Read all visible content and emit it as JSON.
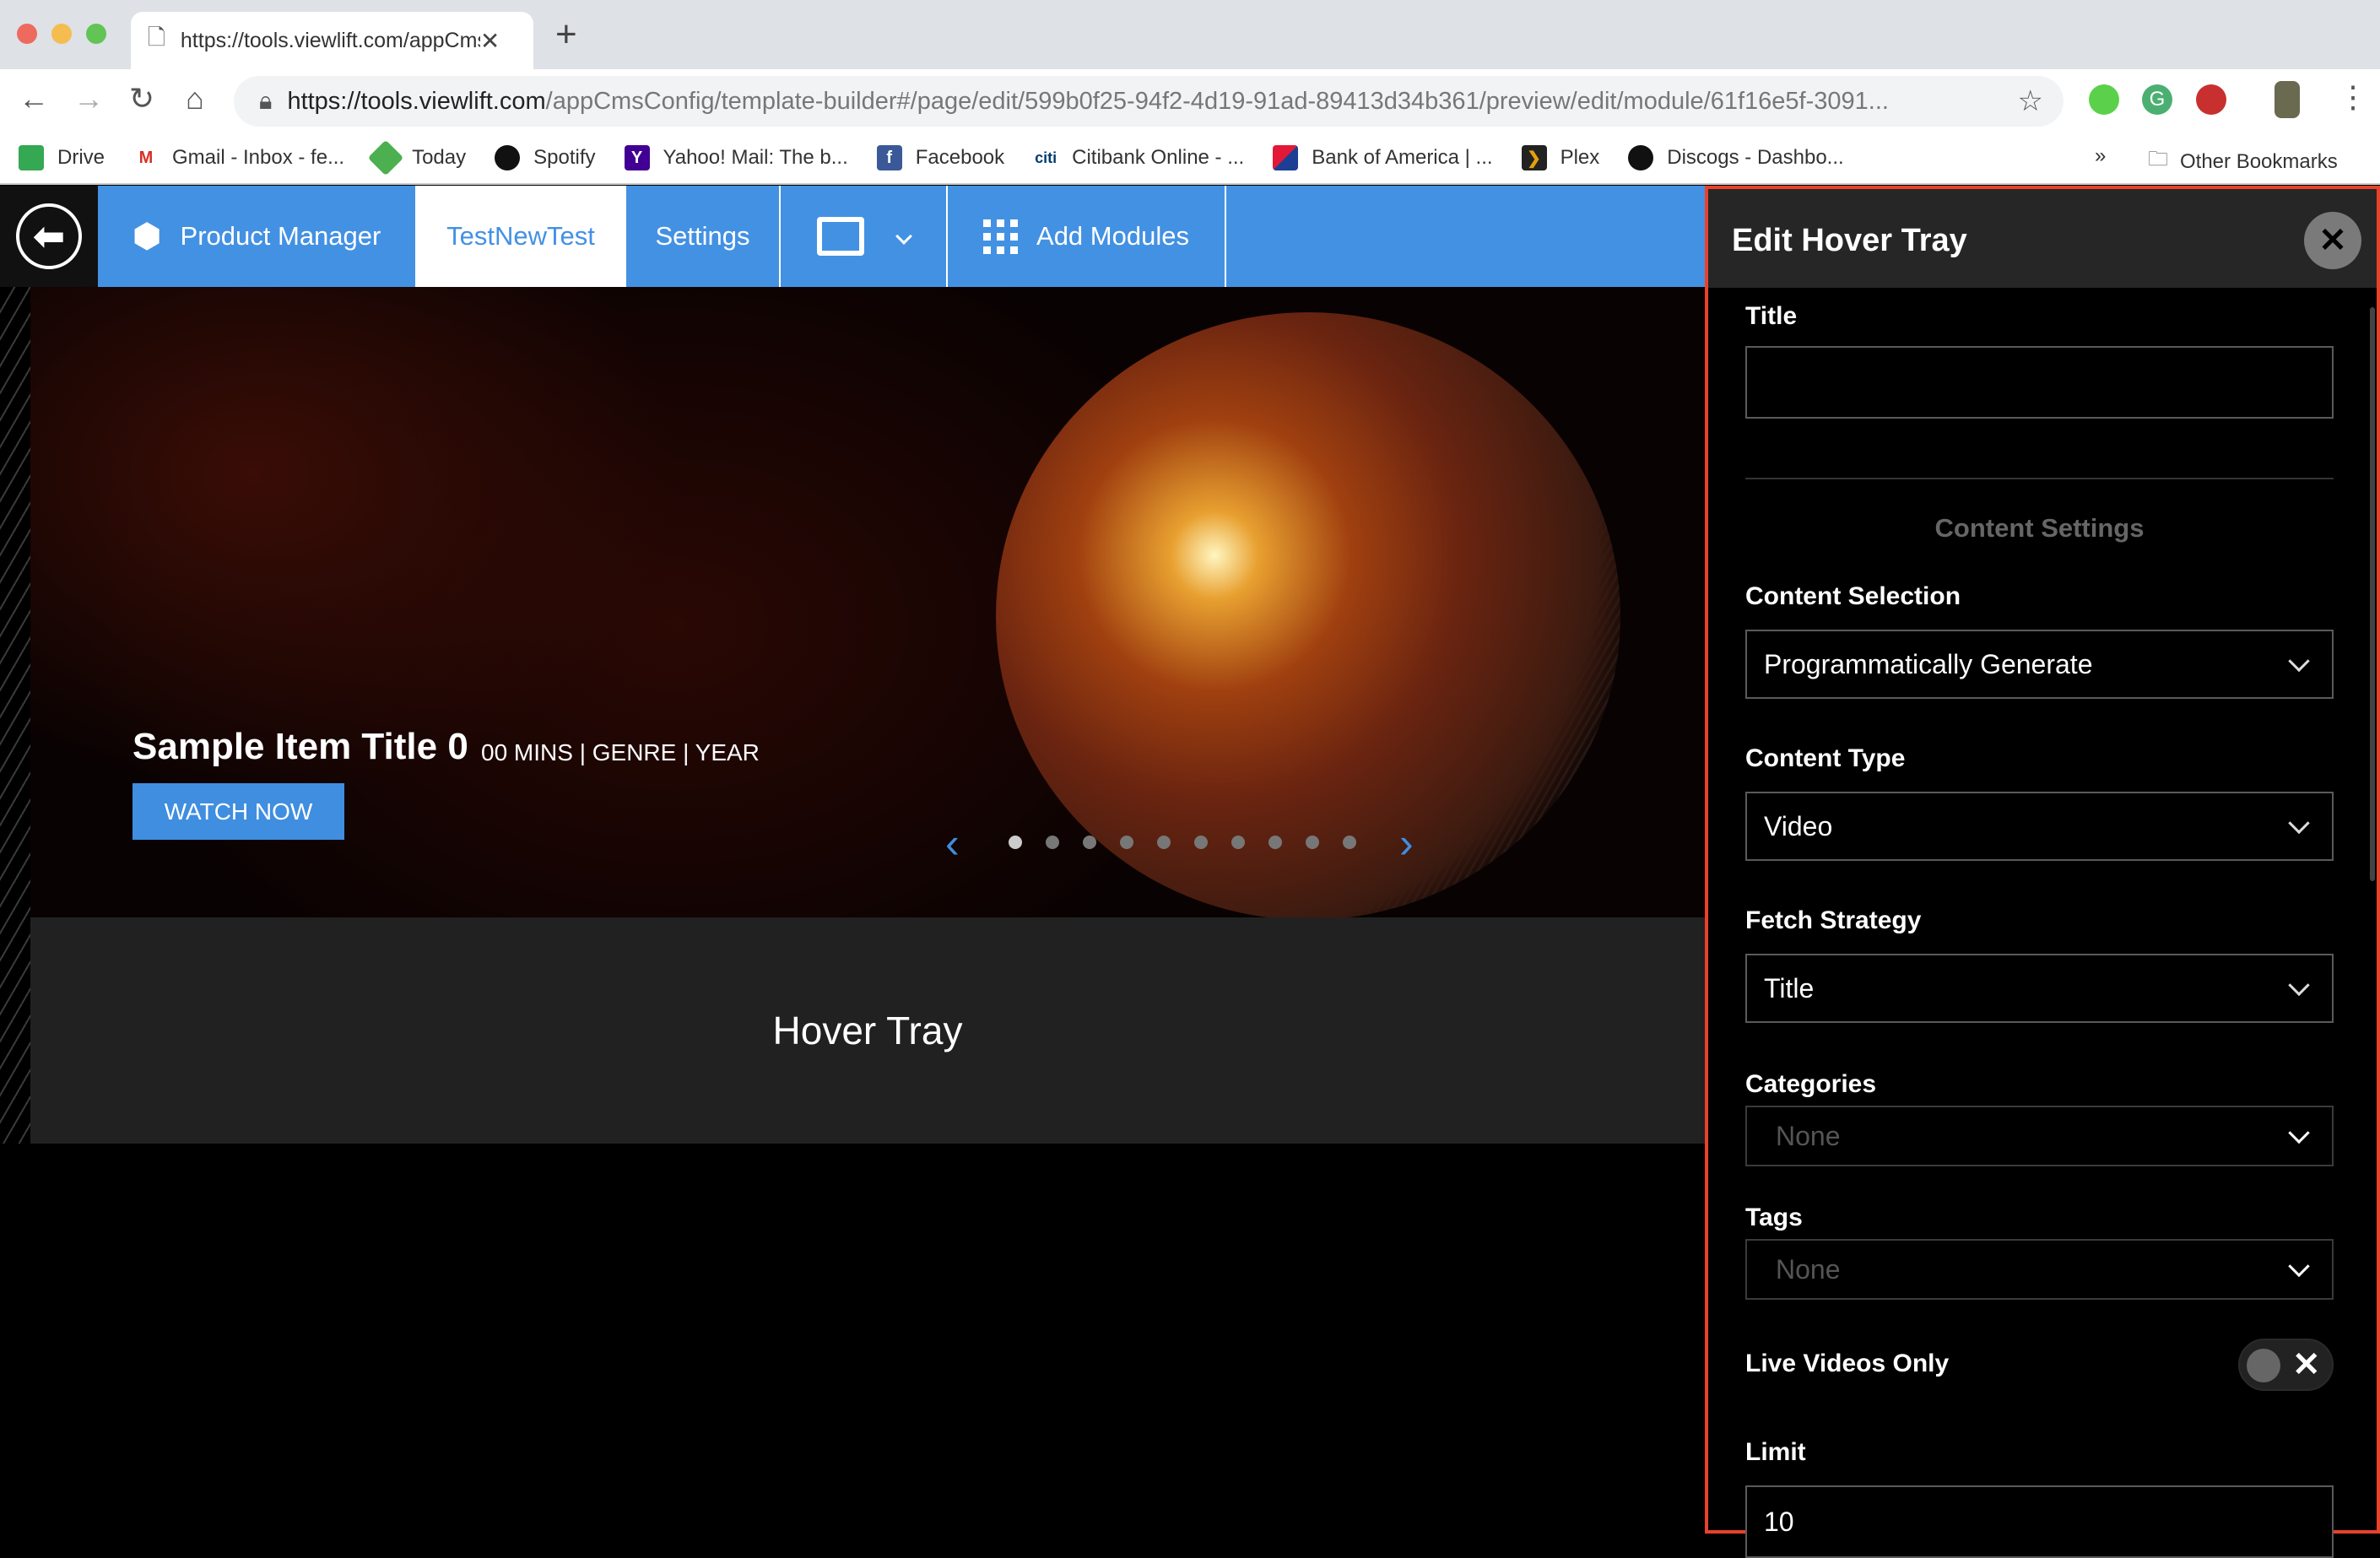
{
  "browser": {
    "tab_title": "https://tools.viewlift.com/appCmsConfig",
    "url_host": "https://tools.viewlift.com",
    "url_path": "/appCmsConfig/template-builder#/page/edit/599b0f25-94f2-4d19-91ad-89413d34b361/preview/edit/module/61f16e5f-3091...",
    "bookmarks": [
      {
        "label": "Drive",
        "icon": "drive-icon",
        "color": "#34a853"
      },
      {
        "label": "Gmail - Inbox - fe...",
        "icon": "gmail-icon",
        "color": "#d93025"
      },
      {
        "label": "Today",
        "icon": "today-icon",
        "color": "#4caf50"
      },
      {
        "label": "Spotify",
        "icon": "spotify-icon",
        "color": "#111111"
      },
      {
        "label": "Yahoo! Mail: The b...",
        "icon": "yahoo-icon",
        "color": "#410093"
      },
      {
        "label": "Facebook",
        "icon": "facebook-icon",
        "color": "#3b5998"
      },
      {
        "label": "Citibank Online - ...",
        "icon": "citi-icon",
        "color": "#003b70"
      },
      {
        "label": "Bank of America | ...",
        "icon": "bofa-icon",
        "color": "#e31837"
      },
      {
        "label": "Plex",
        "icon": "plex-icon",
        "color": "#e5a00d"
      },
      {
        "label": "Discogs - Dashbo...",
        "icon": "discogs-icon",
        "color": "#111111"
      }
    ],
    "more": "»",
    "other_bookmarks": "Other Bookmarks"
  },
  "nav": {
    "product_manager": "Product Manager",
    "page": "TestNewTest",
    "settings": "Settings",
    "add_modules": "Add Modules",
    "accent": "#4391e3"
  },
  "hero": {
    "title": "Sample Item Title 0",
    "meta": "00 MINS | GENRE | YEAR",
    "watch": "WATCH NOW",
    "dots": 10,
    "active_dot": 0
  },
  "tray": {
    "label": "Hover Tray"
  },
  "panel": {
    "title": "Edit Hover Tray",
    "title_label": "Title",
    "title_value": "",
    "section": "Content Settings",
    "content_selection_label": "Content Selection",
    "content_selection": "Programmatically Generate",
    "content_type_label": "Content Type",
    "content_type": "Video",
    "fetch_label": "Fetch Strategy",
    "fetch": "Title",
    "categories_label": "Categories",
    "categories": "None",
    "tags_label": "Tags",
    "tags": "None",
    "live_label": "Live Videos Only",
    "live_on": false,
    "limit_label": "Limit",
    "limit": "10",
    "border_color": "#e8412c"
  }
}
